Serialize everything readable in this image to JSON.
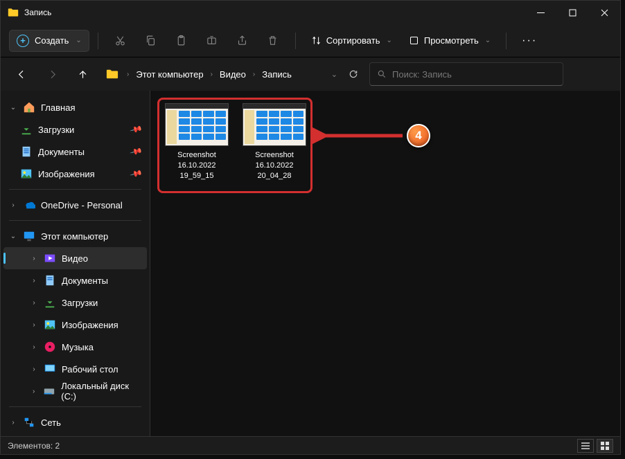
{
  "window": {
    "title": "Запись"
  },
  "toolbar": {
    "new_label": "Создать",
    "sort_label": "Сортировать",
    "view_label": "Просмотреть"
  },
  "breadcrumbs": {
    "items": [
      "Этот компьютер",
      "Видео",
      "Запись"
    ]
  },
  "search": {
    "placeholder": "Поиск: Запись"
  },
  "sidebar": {
    "home": "Главная",
    "downloads": "Загрузки",
    "documents": "Документы",
    "pictures": "Изображения",
    "onedrive": "OneDrive - Personal",
    "thispc": "Этот компьютер",
    "video": "Видео",
    "documents2": "Документы",
    "downloads2": "Загрузки",
    "pictures2": "Изображения",
    "music": "Музыка",
    "desktop": "Рабочий стол",
    "localdisk": "Локальный диск (C:)",
    "network": "Сеть"
  },
  "files": [
    {
      "name_l1": "Screenshot",
      "name_l2": "16.10.2022",
      "name_l3": "19_59_15"
    },
    {
      "name_l1": "Screenshot",
      "name_l2": "16.10.2022",
      "name_l3": "20_04_28"
    }
  ],
  "status": {
    "count_label": "Элементов: 2"
  },
  "annotation": {
    "number": "4"
  }
}
